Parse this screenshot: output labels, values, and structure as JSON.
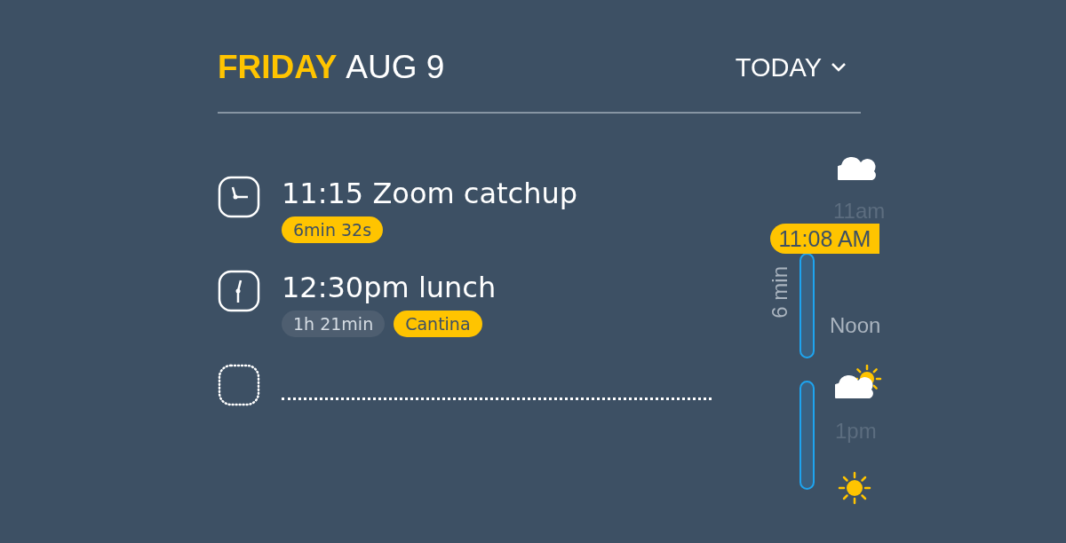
{
  "header": {
    "day": "FRIDAY",
    "date": "AUG 9",
    "range": "TODAY"
  },
  "events": [
    {
      "kind": "quarter",
      "title": "11:15 Zoom catchup",
      "tags": [
        {
          "text": "6min 32s",
          "color": "#ffc400"
        }
      ]
    },
    {
      "kind": "half",
      "title": "12:30pm lunch",
      "tags": [
        {
          "text": "1h 21min",
          "color": "#4e5e70"
        },
        {
          "text": "Cantina",
          "color": "#ffc400"
        }
      ]
    },
    {
      "kind": "empty"
    }
  ],
  "timeline": {
    "now": "11:08 AM",
    "gap_label": "6 min",
    "hours": [
      {
        "text": "11am",
        "faint": true
      },
      {
        "text": "Noon",
        "faint": false
      },
      {
        "text": "1pm",
        "faint": true
      }
    ],
    "weather": [
      {
        "kind": "cloud"
      },
      {
        "kind": "partly-sunny"
      },
      {
        "kind": "sun"
      }
    ],
    "blocks": [
      {
        "kind": "event"
      },
      {
        "kind": "event"
      }
    ]
  }
}
